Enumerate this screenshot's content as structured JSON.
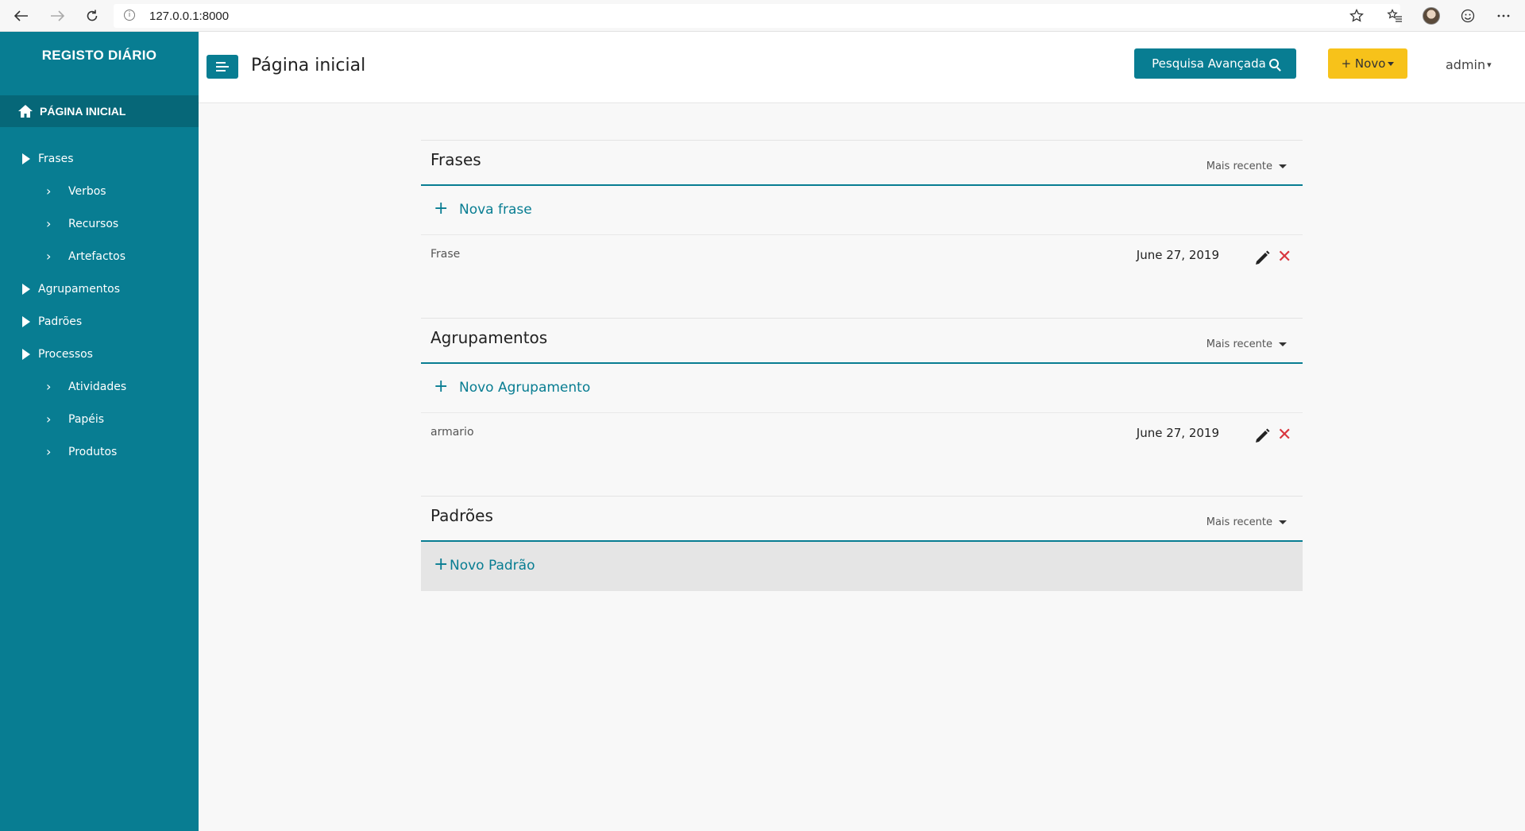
{
  "browser": {
    "url": "127.0.0.1:8000",
    "icons": [
      "back-arrow-icon",
      "forward-arrow-icon",
      "reload-icon",
      "info-icon",
      "star-icon",
      "favorites-icon",
      "profile-avatar",
      "emoji-icon",
      "more-icon"
    ]
  },
  "sidebar": {
    "brand": "REGISTO DIÁRIO",
    "home_label": "PÁGINA INICIAL",
    "items": [
      {
        "label": "Frases",
        "level": 1
      },
      {
        "label": "Verbos",
        "level": 2
      },
      {
        "label": "Recursos",
        "level": 2
      },
      {
        "label": "Artefactos",
        "level": 2
      },
      {
        "label": "Agrupamentos",
        "level": 1
      },
      {
        "label": "Padrões",
        "level": 1
      },
      {
        "label": "Processos",
        "level": 1
      },
      {
        "label": "Atividades",
        "level": 2
      },
      {
        "label": "Papéis",
        "level": 2
      },
      {
        "label": "Produtos",
        "level": 2
      }
    ]
  },
  "header": {
    "title": "Página inicial",
    "search_label": "Pesquisa Avançada",
    "new_label": "+ Novo",
    "user": "admin"
  },
  "sections": [
    {
      "title": "Frases",
      "sort": "Mais recente",
      "add_label": "Nova frase",
      "items": [
        {
          "name": "Frase",
          "date": "June 27, 2019"
        }
      ]
    },
    {
      "title": "Agrupamentos",
      "sort": "Mais recente",
      "add_label": "Novo Agrupamento",
      "items": [
        {
          "name": "armario",
          "date": "June 27, 2019"
        }
      ]
    },
    {
      "title": "Padrões",
      "sort": "Mais recente",
      "add_label": "Novo Padrão",
      "items": []
    }
  ],
  "colors": {
    "primary": "#087d92",
    "sidebar_active": "#066778",
    "accent": "#f7c21a",
    "delete": "#d9363e"
  }
}
